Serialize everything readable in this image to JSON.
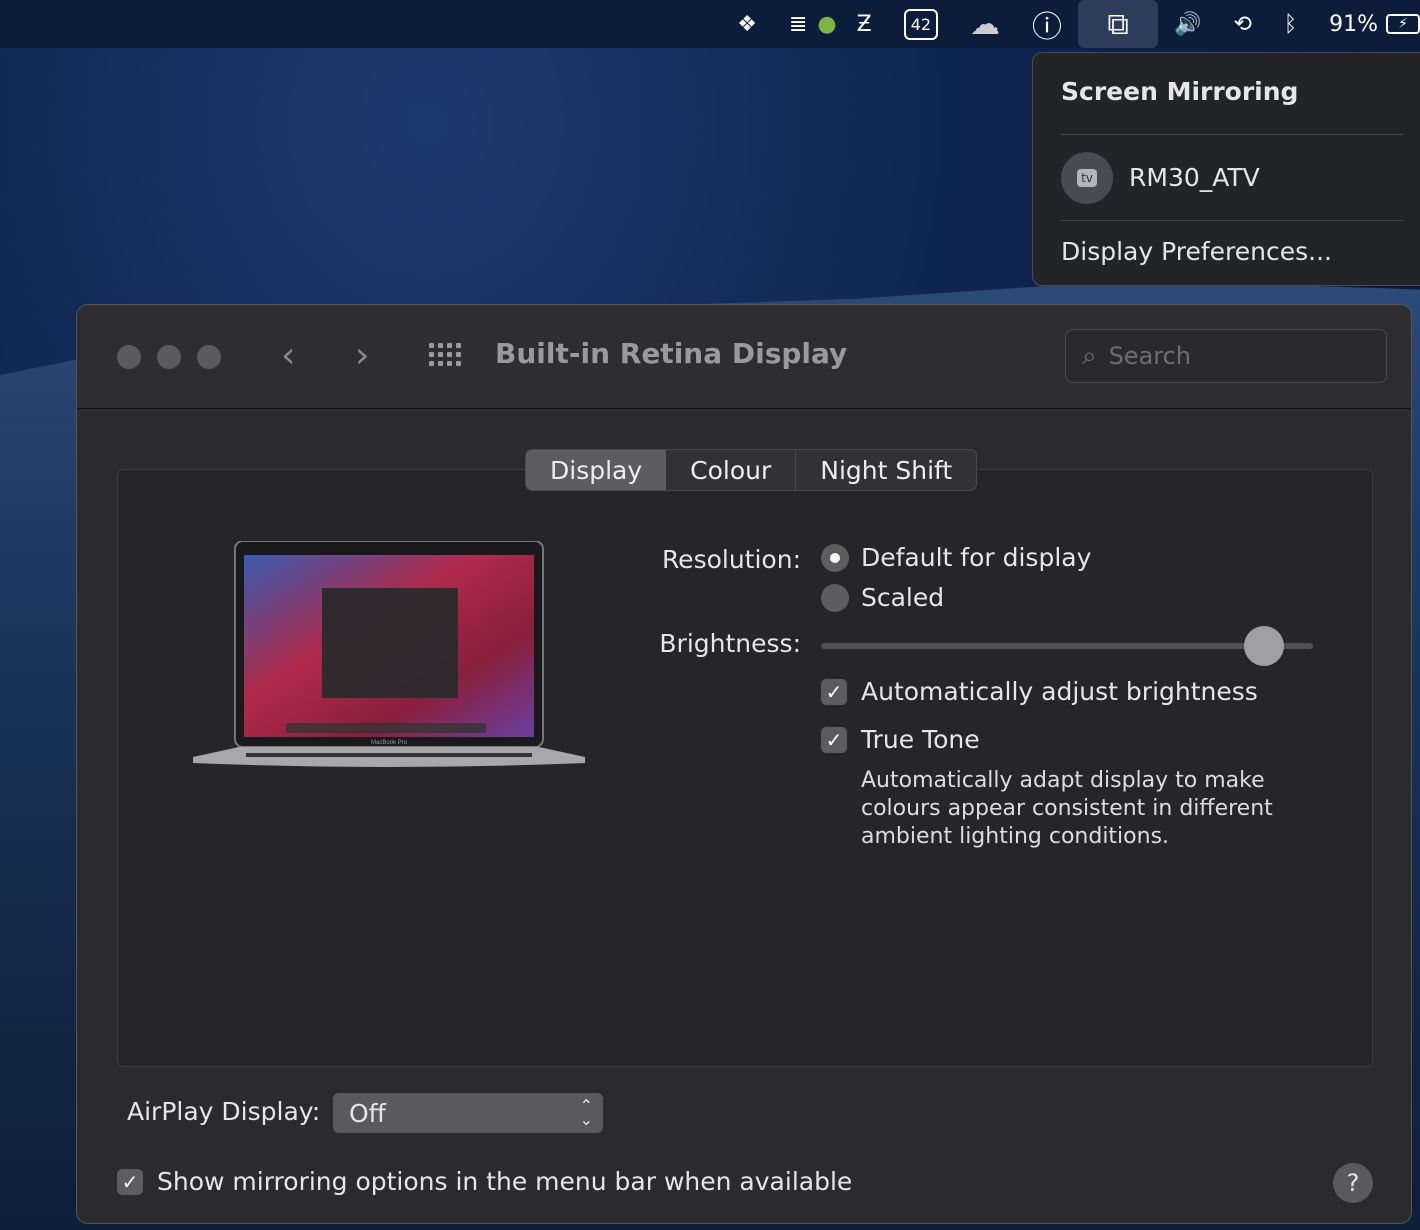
{
  "menubar": {
    "items": [
      {
        "icon": "dropbox-icon",
        "glyph": "❖"
      },
      {
        "icon": "istat-menus-icon",
        "glyph": "≣"
      },
      {
        "icon": "status-green-dot-icon",
        "glyph": "●"
      },
      {
        "icon": "z-app-icon",
        "glyph": "Ƶ"
      },
      {
        "icon": "calendar-42-icon",
        "glyph": "42"
      },
      {
        "icon": "onedrive-cloud-icon",
        "glyph": "☁"
      },
      {
        "icon": "1password-icon",
        "glyph": "ⓘ"
      },
      {
        "icon": "screen-mirroring-icon",
        "glyph": "⧉"
      },
      {
        "icon": "volume-icon",
        "glyph": "🔊"
      },
      {
        "icon": "time-machine-icon",
        "glyph": "⟲"
      },
      {
        "icon": "bluetooth-icon",
        "glyph": "ᛒ"
      }
    ],
    "battery_percent": "91%"
  },
  "popover": {
    "title": "Screen Mirroring",
    "device": "RM30_ATV",
    "device_badge": "tv",
    "preferences": "Display Preferences..."
  },
  "window": {
    "title": "Built-in Retina Display",
    "search_placeholder": "Search",
    "tabs": [
      "Display",
      "Colour",
      "Night Shift"
    ],
    "selected_tab": "Display",
    "resolution_label": "Resolution:",
    "resolution_options": [
      "Default for display",
      "Scaled"
    ],
    "resolution_selected": "Default for display",
    "brightness_label": "Brightness:",
    "brightness_level": 0.9,
    "auto_brightness": {
      "label": "Automatically adjust brightness",
      "checked": true
    },
    "true_tone": {
      "label": "True Tone",
      "checked": true,
      "description": "Automatically adapt display to make colours appear consistent in different ambient lighting conditions."
    },
    "airplay_label": "AirPlay Display:",
    "airplay_value": "Off",
    "show_mirroring": {
      "label": "Show mirroring options in the menu bar when available",
      "checked": true
    },
    "help": "?"
  },
  "laptop_label": "MacBook Pro"
}
